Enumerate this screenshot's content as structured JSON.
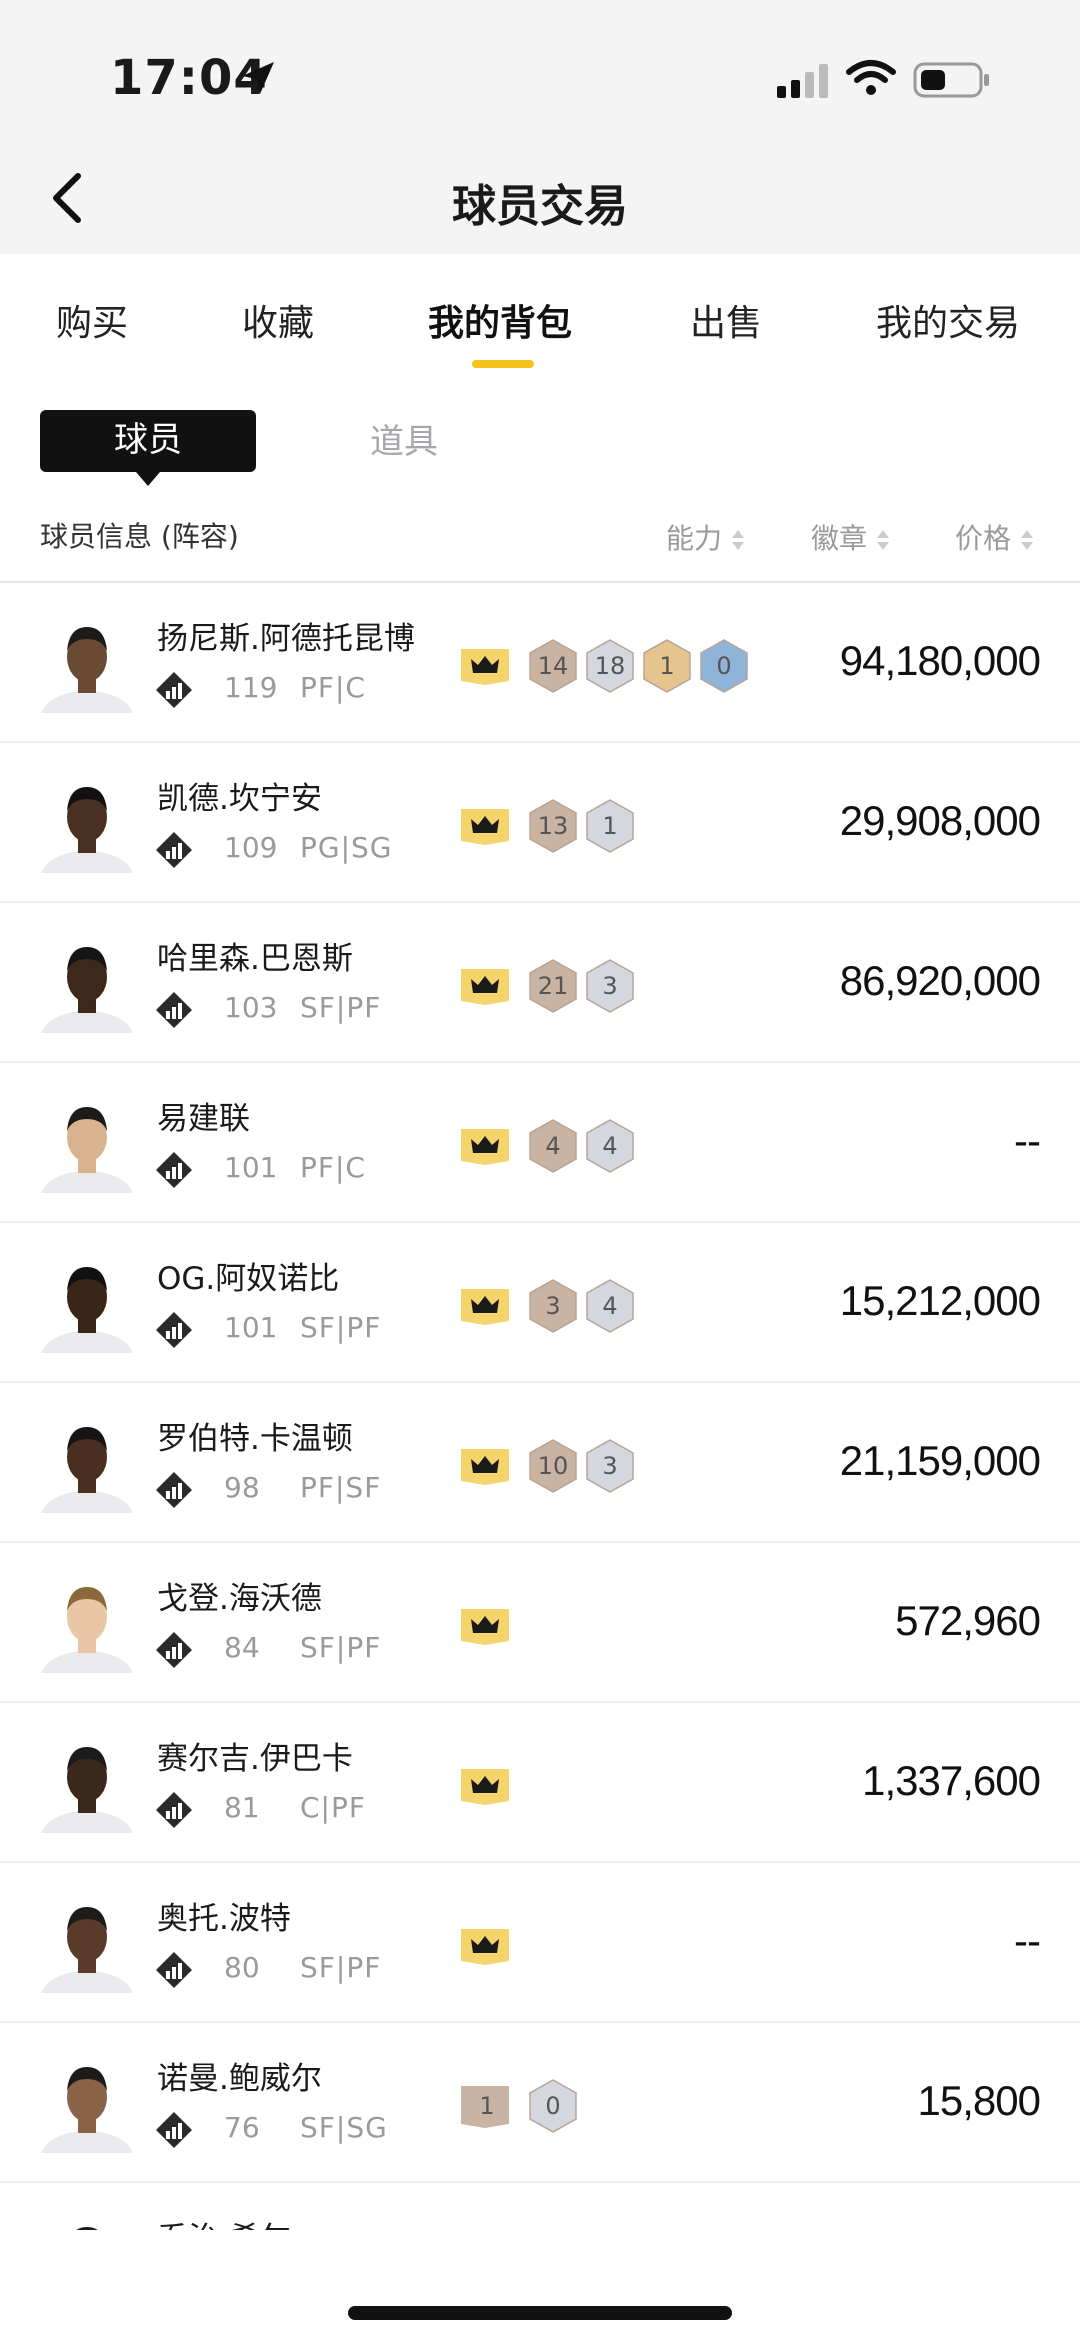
{
  "status": {
    "time": "17:04"
  },
  "header": {
    "title": "球员交易"
  },
  "tabs": [
    "购买",
    "收藏",
    "我的背包",
    "出售",
    "我的交易"
  ],
  "subtabs": {
    "players": "球员",
    "items": "道具"
  },
  "columns": {
    "info": "球员信息 (阵容)",
    "ability": "能力",
    "badge": "徽章",
    "price": "价格"
  },
  "players": [
    {
      "name": "扬尼斯.阿德托昆博",
      "rating": "119",
      "pos": "PF|C",
      "price": "94,180,000",
      "badges": [
        "14",
        "18",
        "1",
        "0"
      ]
    },
    {
      "name": "凯德.坎宁安",
      "rating": "109",
      "pos": "PG|SG",
      "price": "29,908,000",
      "badges": [
        "13",
        "1"
      ]
    },
    {
      "name": "哈里森.巴恩斯",
      "rating": "103",
      "pos": "SF|PF",
      "price": "86,920,000",
      "badges": [
        "21",
        "3"
      ]
    },
    {
      "name": "易建联",
      "rating": "101",
      "pos": "PF|C",
      "price": "--",
      "badges": [
        "4",
        "4"
      ]
    },
    {
      "name": "OG.阿奴诺比",
      "rating": "101",
      "pos": "SF|PF",
      "price": "15,212,000",
      "badges": [
        "3",
        "4"
      ]
    },
    {
      "name": "罗伯特.卡温顿",
      "rating": "98",
      "pos": "PF|SF",
      "price": "21,159,000",
      "badges": [
        "10",
        "3"
      ]
    },
    {
      "name": "戈登.海沃德",
      "rating": "84",
      "pos": "SF|PF",
      "price": "572,960",
      "badges": []
    },
    {
      "name": "赛尔吉.伊巴卡",
      "rating": "81",
      "pos": "C|PF",
      "price": "1,337,600",
      "badges": []
    },
    {
      "name": "奥托.波特",
      "rating": "80",
      "pos": "SF|PF",
      "price": "--",
      "badges": []
    },
    {
      "name": "诺曼.鲍威尔",
      "rating": "76",
      "pos": "SF|SG",
      "price": "15,800",
      "badges": [
        "1",
        "0"
      ]
    },
    {
      "name": "乔治.希尔",
      "rating": "",
      "pos": "",
      "price": "",
      "badges": []
    }
  ],
  "colors": {
    "accent": "#f6c11a",
    "crown": "#f5d56b",
    "bronze": "#c9b3a3",
    "silver": "#d4d7de",
    "gold": "#e6c48f",
    "blue": "#8fb3d9"
  }
}
